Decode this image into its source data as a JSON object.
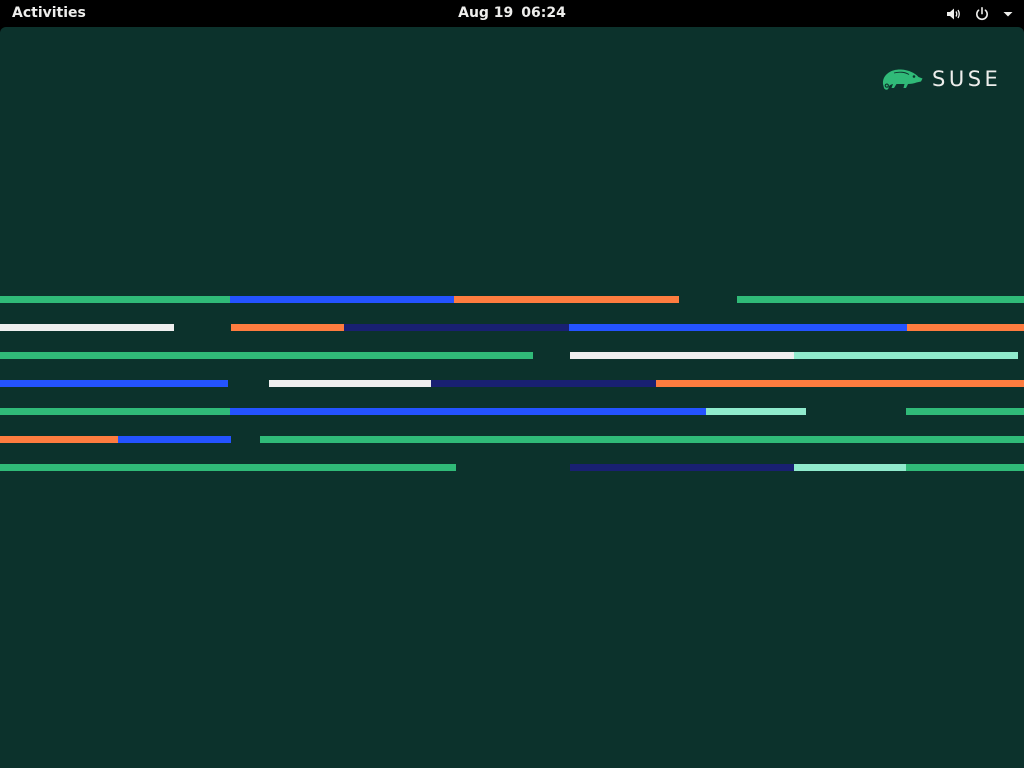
{
  "topbar": {
    "activities_label": "Activities",
    "date": "Aug 19",
    "time": "06:24",
    "icons": [
      "volume-icon",
      "power-icon",
      "chevron-down-icon"
    ]
  },
  "desktop": {
    "logo_text": "SUSE",
    "logo_icon": "chameleon-icon",
    "background_color": "#0c322c"
  },
  "colors": {
    "green": "#30ba78",
    "blue": "#2453ff",
    "orange": "#fe7c3f",
    "navy": "#192072",
    "white": "#efefef",
    "mint": "#90ebcd"
  }
}
